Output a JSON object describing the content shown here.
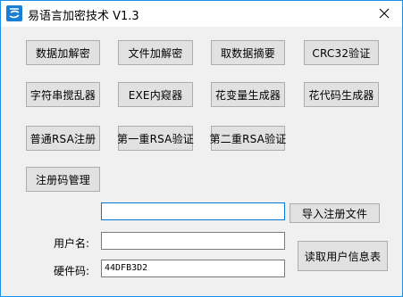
{
  "window": {
    "title": "易语言加密技术 V1.3",
    "close_glyph": "✕"
  },
  "buttons": {
    "row1": [
      "数据加解密",
      "文件加解密",
      "取数据摘要",
      "CRC32验证"
    ],
    "row2": [
      "字符串搅乱器",
      "EXE内窥器",
      "花变量生成器",
      "花代码生成器"
    ],
    "row3": [
      "普通RSA注册",
      "第一重RSA验证",
      "第二重RSA验证"
    ],
    "row4": [
      "注册码管理"
    ],
    "import_reg_file": "导入注册文件",
    "read_user_info": "读取用户信息表"
  },
  "form": {
    "reg_file_path": "",
    "username_label": "用户名:",
    "username_value": "",
    "hardware_label": "硬件码:",
    "hardware_value": "44DFB3D2"
  },
  "colors": {
    "window_border": "#1c8fe8",
    "button_face": "#e1e1e1",
    "focus_border": "#0078d7"
  }
}
